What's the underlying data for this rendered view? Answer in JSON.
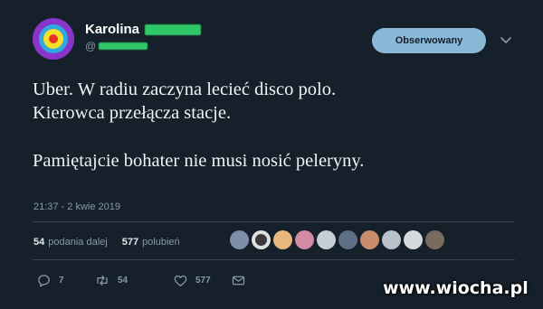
{
  "author": {
    "name": "Karolina",
    "follow_button": "Obserwowany",
    "avatar_colors": [
      "#8a35c9",
      "#2fa9e0",
      "#f3e02a",
      "#e53224"
    ]
  },
  "tweet": {
    "lines_a": [
      "Uber. W radiu zaczyna lecieć disco polo.",
      "Kierowca przełącza stacje."
    ],
    "line_b": "Pamiętajcie bohater nie musi nosić peleryny.",
    "timestamp": "21:37 - 2 kwie 2019"
  },
  "stats": {
    "retweets_count": "54",
    "retweets_label": "podania dalej",
    "likes_count": "577",
    "likes_label": "polubień"
  },
  "actions": {
    "reply_count": "7",
    "retweet_count": "54",
    "like_count": "577"
  },
  "watermark": "www.wiocha.pl",
  "colors": {
    "background": "#15202b",
    "follow_button": "#8ab9d7",
    "muted": "#8899a6",
    "divider": "#38444d"
  }
}
